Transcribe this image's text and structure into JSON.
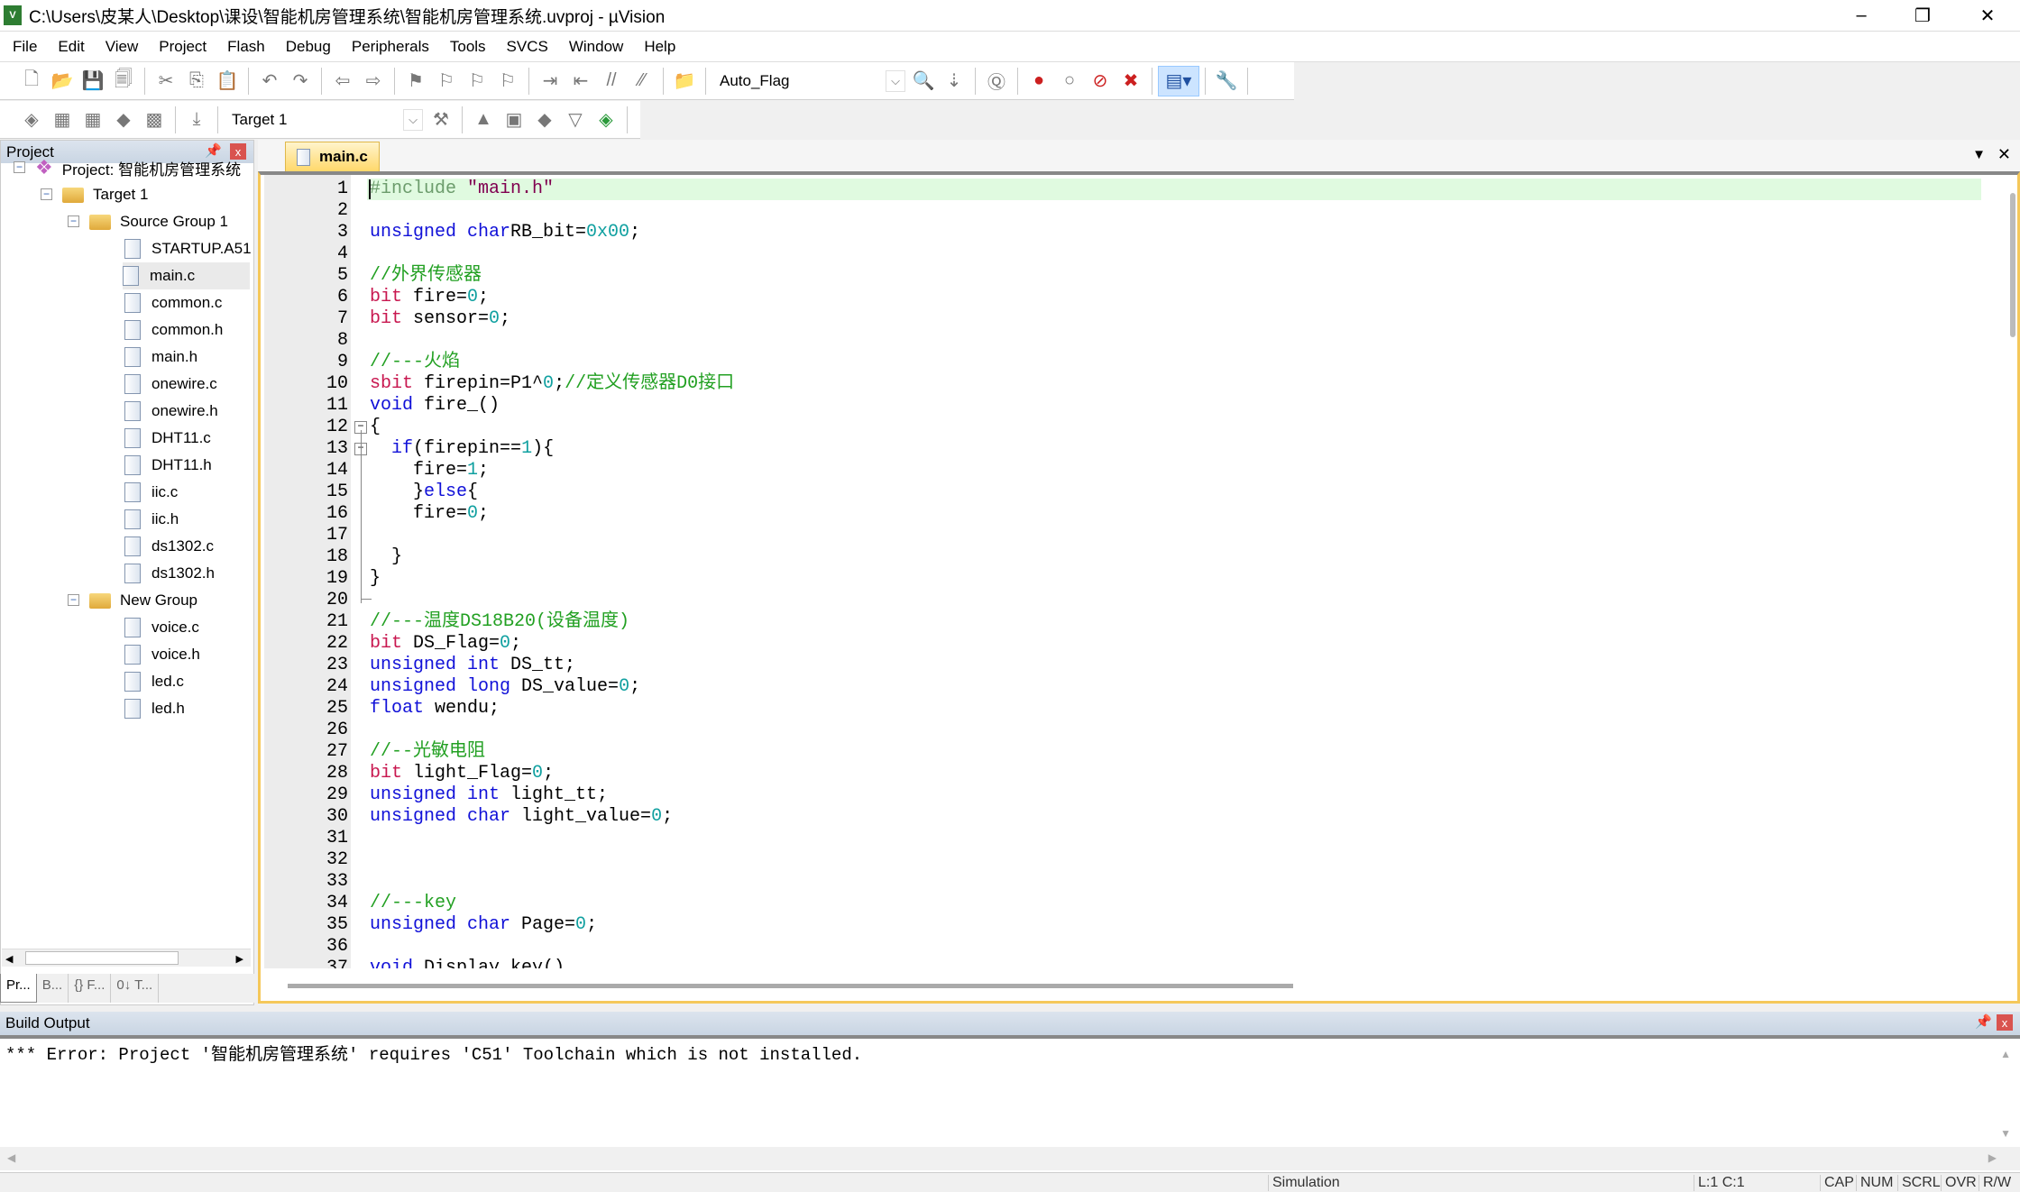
{
  "window": {
    "title": "C:\\Users\\皮某人\\Desktop\\课设\\智能机房管理系统\\智能机房管理系统.uvproj - µVision",
    "minimize": "–",
    "restore": "❐",
    "close": "✕"
  },
  "menu": [
    "File",
    "Edit",
    "View",
    "Project",
    "Flash",
    "Debug",
    "Peripherals",
    "Tools",
    "SVCS",
    "Window",
    "Help"
  ],
  "toolbar1": {
    "groups": [
      [
        [
          "new-file-icon",
          "🗋"
        ],
        [
          "open-file-icon",
          "📂"
        ],
        [
          "save-icon",
          "💾"
        ],
        [
          "save-all-icon",
          "🗐"
        ]
      ],
      [
        [
          "cut-icon",
          "✂"
        ],
        [
          "copy-icon",
          "⎘"
        ],
        [
          "paste-icon",
          "📋"
        ]
      ],
      [
        [
          "undo-icon",
          "↶"
        ],
        [
          "redo-icon",
          "↷"
        ]
      ],
      [
        [
          "navigate-back-icon",
          "⇦"
        ],
        [
          "navigate-forward-icon",
          "⇨"
        ]
      ],
      [
        [
          "bookmark-icon",
          "⚑"
        ],
        [
          "prev-bookmark-icon",
          "⚐"
        ],
        [
          "next-bookmark-icon",
          "⚐"
        ],
        [
          "clear-bookmarks-icon",
          "⚐"
        ]
      ],
      [
        [
          "indent-icon",
          "⇥"
        ],
        [
          "unindent-icon",
          "⇤"
        ],
        [
          "comment-icon",
          "//"
        ],
        [
          "uncomment-icon",
          "⁄⁄"
        ]
      ],
      [
        [
          "find-in-files-icon",
          "📁"
        ]
      ]
    ],
    "find_combo": "Auto_Flag",
    "groups_after": [
      [
        [
          "find-icon",
          "🔍"
        ],
        [
          "incremental-find-icon",
          "⇣"
        ]
      ],
      [
        [
          "debug-session-icon",
          "Ⓠ"
        ]
      ],
      [
        [
          "insert-breakpoint-icon",
          "●"
        ],
        [
          "enable-breakpoint-icon",
          "○"
        ],
        [
          "disable-all-breakpoints-icon",
          "⊘"
        ],
        [
          "kill-all-breakpoints-icon",
          "✖"
        ]
      ],
      [
        [
          "window-layout-icon",
          "▤▾"
        ]
      ],
      [
        [
          "configure-icon",
          "🔧"
        ]
      ]
    ]
  },
  "toolbar2": {
    "groups": [
      [
        [
          "translate-icon",
          "◈"
        ],
        [
          "build-icon",
          "▦"
        ],
        [
          "rebuild-icon",
          "▦"
        ],
        [
          "batch-build-icon",
          "◆"
        ],
        [
          "stop-build-icon",
          "▩"
        ]
      ],
      [
        [
          "download-icon",
          "⤓"
        ]
      ]
    ],
    "target_combo": "Target 1",
    "groups_after": [
      [
        [
          "target-options-icon",
          "⚒"
        ]
      ],
      [
        [
          "options-icon",
          "▲"
        ],
        [
          "manage-components-icon",
          "▣"
        ],
        [
          "pack-installer-icon",
          "◆"
        ],
        [
          "select-pack-icon",
          "▽"
        ],
        [
          "rte-icon",
          "◈"
        ]
      ]
    ]
  },
  "project_panel": {
    "title": "Project",
    "pin": "📌",
    "close": "x",
    "tree": [
      {
        "level": 0,
        "type": "project",
        "label": "Project: 智能机房管理系统"
      },
      {
        "level": 1,
        "type": "target",
        "label": "Target 1"
      },
      {
        "level": 2,
        "type": "group",
        "label": "Source Group 1"
      },
      {
        "level": 3,
        "type": "file",
        "label": "STARTUP.A51"
      },
      {
        "level": 3,
        "type": "file",
        "label": "main.c",
        "selected": true
      },
      {
        "level": 3,
        "type": "file",
        "label": "common.c"
      },
      {
        "level": 3,
        "type": "file",
        "label": "common.h"
      },
      {
        "level": 3,
        "type": "file",
        "label": "main.h"
      },
      {
        "level": 3,
        "type": "file",
        "label": "onewire.c"
      },
      {
        "level": 3,
        "type": "file",
        "label": "onewire.h"
      },
      {
        "level": 3,
        "type": "file",
        "label": "DHT11.c"
      },
      {
        "level": 3,
        "type": "file",
        "label": "DHT11.h"
      },
      {
        "level": 3,
        "type": "file",
        "label": "iic.c"
      },
      {
        "level": 3,
        "type": "file",
        "label": "iic.h"
      },
      {
        "level": 3,
        "type": "file",
        "label": "ds1302.c"
      },
      {
        "level": 3,
        "type": "file",
        "label": "ds1302.h"
      },
      {
        "level": 2,
        "type": "group",
        "label": "New Group"
      },
      {
        "level": 3,
        "type": "file",
        "label": "voice.c"
      },
      {
        "level": 3,
        "type": "file",
        "label": "voice.h"
      },
      {
        "level": 3,
        "type": "file",
        "label": "led.c"
      },
      {
        "level": 3,
        "type": "file",
        "label": "led.h"
      }
    ],
    "tabs": [
      "Pr...",
      "B...",
      "{} F...",
      "0↓ T..."
    ]
  },
  "editor": {
    "tab": "main.c",
    "current_line": 1,
    "lines": [
      [
        [
          "p",
          "#include "
        ],
        [
          "s",
          "\"main.h\""
        ]
      ],
      [],
      [
        [
          "k",
          "unsigned char"
        ],
        [
          "",
          "RB_bit="
        ],
        [
          "n",
          "0x00"
        ],
        [
          "",
          ";"
        ]
      ],
      [],
      [
        [
          "c",
          "//外界传感器"
        ]
      ],
      [
        [
          "b",
          "bit"
        ],
        [
          "",
          " fire="
        ],
        [
          "n",
          "0"
        ],
        [
          "",
          ";"
        ]
      ],
      [
        [
          "b",
          "bit"
        ],
        [
          "",
          " sensor="
        ],
        [
          "n",
          "0"
        ],
        [
          "",
          ";"
        ]
      ],
      [],
      [
        [
          "c",
          "//---火焰"
        ]
      ],
      [
        [
          "b",
          "sbit"
        ],
        [
          "",
          " firepin=P1^"
        ],
        [
          "n",
          "0"
        ],
        [
          "",
          ";"
        ],
        [
          "c",
          "//定义传感器D0接口"
        ]
      ],
      [
        [
          "k",
          "void"
        ],
        [
          "",
          " fire_()"
        ]
      ],
      [
        [
          "",
          "{"
        ]
      ],
      [
        [
          "",
          "  "
        ],
        [
          "k",
          "if"
        ],
        [
          "",
          "(firepin=="
        ],
        [
          "n",
          "1"
        ],
        [
          "",
          "){"
        ]
      ],
      [
        [
          "",
          "    fire="
        ],
        [
          "n",
          "1"
        ],
        [
          "",
          ";"
        ]
      ],
      [
        [
          "",
          "    }"
        ],
        [
          "k",
          "else"
        ],
        [
          "",
          "{"
        ]
      ],
      [
        [
          "",
          "    fire="
        ],
        [
          "n",
          "0"
        ],
        [
          "",
          ";"
        ]
      ],
      [],
      [
        [
          "",
          "  }"
        ]
      ],
      [
        [
          "",
          "}"
        ]
      ],
      [],
      [
        [
          "c",
          "//---温度DS18B20(设备温度)"
        ]
      ],
      [
        [
          "b",
          "bit"
        ],
        [
          "",
          " DS_Flag="
        ],
        [
          "n",
          "0"
        ],
        [
          "",
          ";"
        ]
      ],
      [
        [
          "k",
          "unsigned int"
        ],
        [
          "",
          " DS_tt;"
        ]
      ],
      [
        [
          "k",
          "unsigned long"
        ],
        [
          "",
          " DS_value="
        ],
        [
          "n",
          "0"
        ],
        [
          "",
          ";"
        ]
      ],
      [
        [
          "k",
          "float"
        ],
        [
          "",
          " wendu;"
        ]
      ],
      [],
      [
        [
          "c",
          "//--光敏电阻"
        ]
      ],
      [
        [
          "b",
          "bit"
        ],
        [
          "",
          " light_Flag="
        ],
        [
          "n",
          "0"
        ],
        [
          "",
          ";"
        ]
      ],
      [
        [
          "k",
          "unsigned int"
        ],
        [
          "",
          " light_tt;"
        ]
      ],
      [
        [
          "k",
          "unsigned char"
        ],
        [
          "",
          " light_value="
        ],
        [
          "n",
          "0"
        ],
        [
          "",
          ";"
        ]
      ],
      [],
      [],
      [],
      [
        [
          "c",
          "//---key"
        ]
      ],
      [
        [
          "k",
          "unsigned char"
        ],
        [
          "",
          " Page="
        ],
        [
          "n",
          "0"
        ],
        [
          "",
          ";"
        ]
      ],
      [],
      [
        [
          "k",
          "void"
        ],
        [
          "",
          " Display_key()"
        ]
      ]
    ],
    "fold_markers": {
      "12": "−",
      "13": "−"
    },
    "syntax_colors": {
      "keyword": "#1010d8",
      "sfr_type": "#c8174f",
      "number": "#10a0a0",
      "comment": "#22a022",
      "preprocessor": "#6c9c6c",
      "string": "#800050",
      "current_line": "#e0fae0"
    }
  },
  "build_output": {
    "title": "Build Output",
    "pin": "📌",
    "close": "x",
    "text": "*** Error: Project '智能机房管理系统' requires 'C51' Toolchain which is not installed."
  },
  "status": {
    "mode": "Simulation",
    "position": "L:1 C:1",
    "cap": "CAP",
    "num": "NUM",
    "scrl": "SCRL",
    "ovr": "OVR",
    "rw": "R/W"
  }
}
